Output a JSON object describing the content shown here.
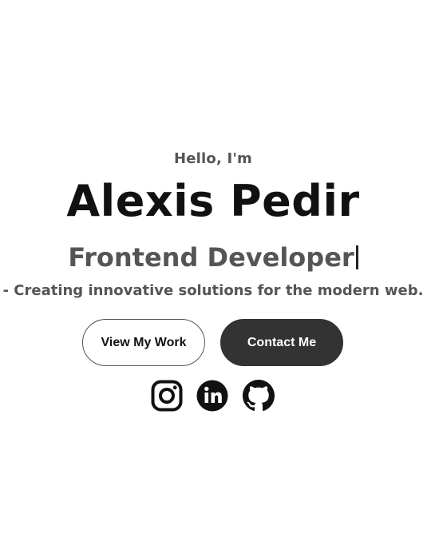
{
  "hero": {
    "greeting": "Hello, I'm",
    "name": "Alexis Pedir",
    "role": "Frontend Developer",
    "tagline": "- Creating innovative solutions for the modern web."
  },
  "buttons": {
    "view_work_label": "View My Work",
    "contact_label": "Contact Me"
  },
  "socials": [
    {
      "icon": "instagram-icon"
    },
    {
      "icon": "linkedin-icon"
    },
    {
      "icon": "github-icon"
    }
  ],
  "colors": {
    "text_dark": "#111111",
    "text_muted": "#555555",
    "button_filled": "#333333",
    "background": "#ffffff"
  }
}
